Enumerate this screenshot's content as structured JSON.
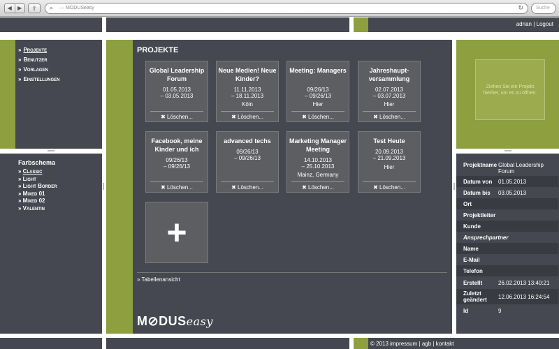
{
  "browser": {
    "url": "— MODUSeasy",
    "search_placeholder": "Suche"
  },
  "header": {
    "user": "adrian",
    "separator": "|",
    "logout": "Logout"
  },
  "nav": {
    "items": [
      {
        "label": "Projekte",
        "active": true
      },
      {
        "label": "Benutzer"
      },
      {
        "label": "Vorlagen"
      },
      {
        "label": "Einstellungen"
      }
    ]
  },
  "schemes": {
    "title": "Farbschema",
    "items": [
      {
        "label": "Classic",
        "active": true
      },
      {
        "label": "Light"
      },
      {
        "label": "Light Border"
      },
      {
        "label": "Mixed 01"
      },
      {
        "label": "Mixed 02"
      },
      {
        "label": "Valentin"
      }
    ]
  },
  "main": {
    "title": "PROJEKTE",
    "delete_label": "✖ Löschen...",
    "projects": [
      {
        "title": "Global Leadership Forum",
        "start": "01.05.2013",
        "end": "– 03.05.2013",
        "location": ""
      },
      {
        "title": "Neue Medien! Neue Kinder?",
        "start": "11.11.2013",
        "end": "– 18.11.2013",
        "location": "Köln"
      },
      {
        "title": "Meeting: Managers",
        "start": "09/26/13",
        "end": "– 09/26/13",
        "location": "Hier"
      },
      {
        "title": "Jahreshaupt-versammlung",
        "start": "02.07.2013",
        "end": "– 03.07.2013",
        "location": "Hier"
      },
      {
        "title": "Facebook, meine Kinder und ich",
        "start": "09/26/13",
        "end": "– 09/26/13",
        "location": ""
      },
      {
        "title": "advanced techs",
        "start": "09/26/13",
        "end": "– 09/26/13",
        "location": ""
      },
      {
        "title": "Marketing Manager Meeting",
        "start": "14.10.2013",
        "end": "– 25.10.2013",
        "location": "Mainz, Germany"
      },
      {
        "title": "Test Heute",
        "start": "20.09.2013",
        "end": "– 21.09.2013",
        "location": "Hier"
      }
    ],
    "add_label": "+",
    "table_view": "» Tabellenansicht",
    "logo_bold": "M⊘DUS",
    "logo_italic": "easy"
  },
  "dropzone": {
    "text": "Ziehen Sie ein Projekt hierher, um es zu öffnen."
  },
  "details": {
    "rows": [
      {
        "key": "Projektname",
        "value": "Global Leadership Forum"
      },
      {
        "key": "Datum von",
        "value": "01.05.2013"
      },
      {
        "key": "Datum bis",
        "value": "03.05.2013"
      },
      {
        "key": "Ort",
        "value": ""
      },
      {
        "key": "Projektleiter",
        "value": ""
      },
      {
        "key": "Kunde",
        "value": ""
      },
      {
        "key": "Ansprechpartner",
        "value": "",
        "italic": true
      },
      {
        "key": "Name",
        "value": ""
      },
      {
        "key": "E-Mail",
        "value": ""
      },
      {
        "key": "Telefon",
        "value": ""
      },
      {
        "key": "Erstellt",
        "value": "26.02.2013 13:40:21"
      },
      {
        "key": "Zuletzt geändert",
        "value": "12.06.2013 16:24:54"
      },
      {
        "key": "Id",
        "value": "9"
      }
    ]
  },
  "footer": {
    "copyright": "© 2013",
    "impressum": "impressum",
    "agb": "agb",
    "kontakt": "kontakt",
    "separator": "|"
  },
  "colors": {
    "panel": "#454850",
    "accent": "#8d9f3e"
  }
}
